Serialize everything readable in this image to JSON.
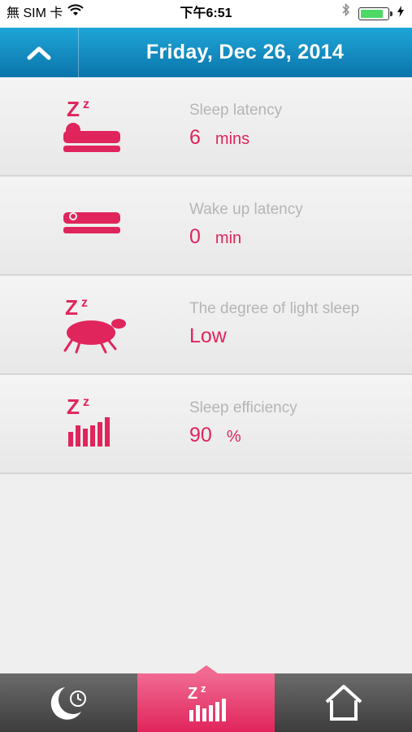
{
  "status_bar": {
    "carrier": "無 SIM 卡",
    "time": "下午6:51",
    "battery_level": 0.85
  },
  "header": {
    "title": "Friday, Dec 26, 2014"
  },
  "metrics": [
    {
      "label": "Sleep latency",
      "value": "6",
      "unit": "mins",
      "icon": "sleep-latency-icon"
    },
    {
      "label": "Wake up latency",
      "value": "0",
      "unit": "min",
      "icon": "wake-latency-icon"
    },
    {
      "label": "The degree of light sleep",
      "value": "Low",
      "unit": "",
      "icon": "light-sleep-sheep-icon"
    },
    {
      "label": "Sleep efficiency",
      "value": "90",
      "unit": "%",
      "icon": "sleep-efficiency-icon"
    }
  ],
  "colors": {
    "accent": "#e0255c",
    "header": "#0b74aa",
    "label": "#b5b5b5"
  },
  "tabs": [
    {
      "icon": "moon-clock-icon",
      "active": false
    },
    {
      "icon": "sleep-stats-icon",
      "active": true
    },
    {
      "icon": "home-icon",
      "active": false
    }
  ]
}
